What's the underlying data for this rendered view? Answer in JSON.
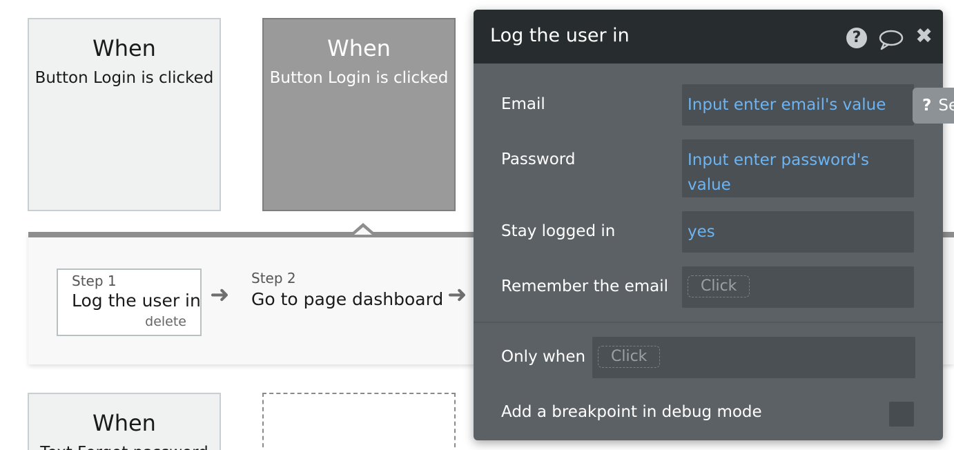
{
  "events": [
    {
      "when": "When",
      "description": "Button Login is clicked"
    },
    {
      "when": "When",
      "description": "Button Login is clicked"
    },
    {
      "when": "When",
      "description": "Text Forgot password"
    }
  ],
  "steps": [
    {
      "number": "Step 1",
      "title": "Log the user in",
      "delete_label": "delete"
    },
    {
      "number": "Step 2",
      "title": "Go to page dashboard"
    }
  ],
  "action_panel": {
    "title": "Log the user in",
    "icons": [
      "help-icon",
      "comment-icon",
      "close-icon"
    ],
    "fields": {
      "email": {
        "label": "Email",
        "value": "Input enter email's value"
      },
      "password": {
        "label": "Password",
        "value": "Input enter password's value"
      },
      "stay_logged_in": {
        "label": "Stay logged in",
        "value": "yes"
      },
      "remember_email": {
        "label": "Remember the email",
        "placeholder": "Click"
      },
      "only_when": {
        "label": "Only when",
        "placeholder": "Click"
      },
      "breakpoint": {
        "label": "Add a breakpoint in debug mode"
      }
    }
  },
  "reference_tab": {
    "icon": "?",
    "label": "See reference"
  },
  "colors": {
    "panel_bg": "#5c6165",
    "header_bg": "#272c2f",
    "value_text": "#6cb4f2",
    "selected_card": "#9a9a9a"
  }
}
